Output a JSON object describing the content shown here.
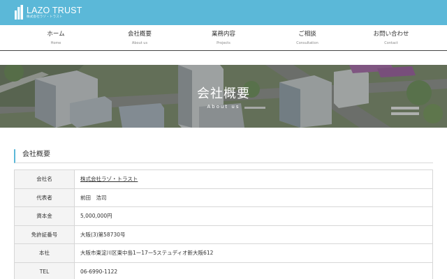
{
  "header": {
    "logo_title": "LAZO TRUST",
    "logo_sub": "株式会社ラゾ・トラスト",
    "bar_color": "#5bb8d8"
  },
  "nav": {
    "items": [
      {
        "label": "ホーム",
        "sub": "Home"
      },
      {
        "label": "会社概要",
        "sub": "About us"
      },
      {
        "label": "業務内容",
        "sub": "Projects"
      },
      {
        "label": "ご相談",
        "sub": "Consultation"
      },
      {
        "label": "お問い合わせ",
        "sub": "Contact"
      }
    ]
  },
  "hero": {
    "title": "会社概要",
    "subtitle": "About us"
  },
  "section": {
    "heading": "会社概要"
  },
  "company": {
    "rows": [
      {
        "label": "会社名",
        "value": "株式会社ラゾ・トラスト"
      },
      {
        "label": "代表者",
        "value": "前田　浩司"
      },
      {
        "label": "資本金",
        "value": "5,000,000円"
      },
      {
        "label": "免許証番号",
        "value": "大阪(3)第58730号"
      },
      {
        "label": "本社",
        "value": "大阪市東淀川区東中島1ー17ー5ステュディオ新大阪612"
      },
      {
        "label": "TEL",
        "value": "06-6990-1122"
      }
    ]
  },
  "icons": [
    "building-logo-icon"
  ]
}
